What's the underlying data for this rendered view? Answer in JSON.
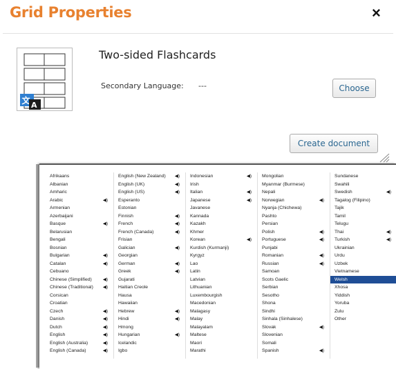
{
  "header": {
    "title": "Grid Properties",
    "close_label": "×"
  },
  "document": {
    "title": "Two-sided Flashcards",
    "secondary_language_label": "Secondary Language:",
    "secondary_language_value": "---",
    "choose_label": "Choose",
    "create_label": "Create document"
  },
  "language_columns": [
    [
      {
        "name": "Afrikaans",
        "audio": false
      },
      {
        "name": "Albanian",
        "audio": false
      },
      {
        "name": "Amharic",
        "audio": false
      },
      {
        "name": "Arabic",
        "audio": true
      },
      {
        "name": "Armenian",
        "audio": false
      },
      {
        "name": "Azerbaijani",
        "audio": false
      },
      {
        "name": "Basque",
        "audio": true
      },
      {
        "name": "Belarusian",
        "audio": false
      },
      {
        "name": "Bengali",
        "audio": false
      },
      {
        "name": "Bosnian",
        "audio": false
      },
      {
        "name": "Bulgarian",
        "audio": true
      },
      {
        "name": "Catalan",
        "audio": true
      },
      {
        "name": "Cebuano",
        "audio": false
      },
      {
        "name": "Chinese (Simplified)",
        "audio": true
      },
      {
        "name": "Chinese (Traditional)",
        "audio": true
      },
      {
        "name": "Corsican",
        "audio": false
      },
      {
        "name": "Croatian",
        "audio": false
      },
      {
        "name": "Czech",
        "audio": true
      },
      {
        "name": "Danish",
        "audio": true
      },
      {
        "name": "Dutch",
        "audio": true
      },
      {
        "name": "English",
        "audio": true
      },
      {
        "name": "English (Australia)",
        "audio": true
      },
      {
        "name": "English (Canada)",
        "audio": true
      }
    ],
    [
      {
        "name": "English (New Zealand)",
        "audio": true
      },
      {
        "name": "English (UK)",
        "audio": true
      },
      {
        "name": "English (US)",
        "audio": true
      },
      {
        "name": "Esperanto",
        "audio": false
      },
      {
        "name": "Estonian",
        "audio": false
      },
      {
        "name": "Finnish",
        "audio": true
      },
      {
        "name": "French",
        "audio": true
      },
      {
        "name": "French (Canada)",
        "audio": true
      },
      {
        "name": "Frisian",
        "audio": false
      },
      {
        "name": "Galician",
        "audio": true
      },
      {
        "name": "Georgian",
        "audio": false
      },
      {
        "name": "German",
        "audio": true
      },
      {
        "name": "Greek",
        "audio": true
      },
      {
        "name": "Gujarati",
        "audio": false
      },
      {
        "name": "Haitian Creole",
        "audio": false
      },
      {
        "name": "Hausa",
        "audio": false
      },
      {
        "name": "Hawaiian",
        "audio": false
      },
      {
        "name": "Hebrew",
        "audio": true
      },
      {
        "name": "Hindi",
        "audio": true
      },
      {
        "name": "Hmong",
        "audio": false
      },
      {
        "name": "Hungarian",
        "audio": true
      },
      {
        "name": "Icelandic",
        "audio": false
      },
      {
        "name": "Igbo",
        "audio": false
      }
    ],
    [
      {
        "name": "Indonesian",
        "audio": true
      },
      {
        "name": "Irish",
        "audio": false
      },
      {
        "name": "Italian",
        "audio": true
      },
      {
        "name": "Japanese",
        "audio": true
      },
      {
        "name": "Javanese",
        "audio": false
      },
      {
        "name": "Kannada",
        "audio": false
      },
      {
        "name": "Kazakh",
        "audio": false
      },
      {
        "name": "Khmer",
        "audio": false
      },
      {
        "name": "Korean",
        "audio": true
      },
      {
        "name": "Kurdish (Kurmanji)",
        "audio": false
      },
      {
        "name": "Kyrgyz",
        "audio": false
      },
      {
        "name": "Lao",
        "audio": false
      },
      {
        "name": "Latin",
        "audio": false
      },
      {
        "name": "Latvian",
        "audio": false
      },
      {
        "name": "Lithuanian",
        "audio": false
      },
      {
        "name": "Luxembourgish",
        "audio": false
      },
      {
        "name": "Macedonian",
        "audio": false
      },
      {
        "name": "Malagasy",
        "audio": false
      },
      {
        "name": "Malay",
        "audio": false
      },
      {
        "name": "Malayalam",
        "audio": false
      },
      {
        "name": "Maltese",
        "audio": false
      },
      {
        "name": "Maori",
        "audio": false
      },
      {
        "name": "Marathi",
        "audio": false
      }
    ],
    [
      {
        "name": "Mongolian",
        "audio": false
      },
      {
        "name": "Myanmar (Burmese)",
        "audio": false
      },
      {
        "name": "Nepali",
        "audio": false
      },
      {
        "name": "Norwegian",
        "audio": true
      },
      {
        "name": "Nyanja (Chichewa)",
        "audio": false
      },
      {
        "name": "Pashto",
        "audio": false
      },
      {
        "name": "Persian",
        "audio": false
      },
      {
        "name": "Polish",
        "audio": true
      },
      {
        "name": "Portuguese",
        "audio": true
      },
      {
        "name": "Punjabi",
        "audio": false
      },
      {
        "name": "Romanian",
        "audio": true
      },
      {
        "name": "Russian",
        "audio": true
      },
      {
        "name": "Samoan",
        "audio": false
      },
      {
        "name": "Scots Gaelic",
        "audio": false
      },
      {
        "name": "Serbian",
        "audio": false
      },
      {
        "name": "Sesotho",
        "audio": false
      },
      {
        "name": "Shona",
        "audio": false
      },
      {
        "name": "Sindhi",
        "audio": false
      },
      {
        "name": "Sinhala (Sinhalese)",
        "audio": false
      },
      {
        "name": "Slovak",
        "audio": true
      },
      {
        "name": "Slovenian",
        "audio": false
      },
      {
        "name": "Somali",
        "audio": false
      },
      {
        "name": "Spanish",
        "audio": true
      }
    ],
    [
      {
        "name": "Sundanese",
        "audio": false
      },
      {
        "name": "Swahili",
        "audio": false
      },
      {
        "name": "Swedish",
        "audio": true
      },
      {
        "name": "Tagalog (Filipino)",
        "audio": false
      },
      {
        "name": "Tajik",
        "audio": false
      },
      {
        "name": "Tamil",
        "audio": false
      },
      {
        "name": "Telugu",
        "audio": false
      },
      {
        "name": "Thai",
        "audio": true
      },
      {
        "name": "Turkish",
        "audio": true
      },
      {
        "name": "Ukrainian",
        "audio": false
      },
      {
        "name": "Urdu",
        "audio": false
      },
      {
        "name": "Uzbek",
        "audio": false
      },
      {
        "name": "Vietnamese",
        "audio": false
      },
      {
        "name": "Welsh",
        "audio": false,
        "selected": true
      },
      {
        "name": "Xhosa",
        "audio": false
      },
      {
        "name": "Yiddish",
        "audio": false
      },
      {
        "name": "Yoruba",
        "audio": false
      },
      {
        "name": "Zulu",
        "audio": false
      },
      {
        "name": "Other",
        "audio": false
      }
    ]
  ],
  "colors": {
    "title": "#e8812f",
    "button_text": "#2a6690",
    "selection": "#1f4e96"
  },
  "icons": {
    "close": "close-icon",
    "audio": "speaker-icon",
    "translate": "translate-icon",
    "resize": "resize-grip-icon"
  }
}
